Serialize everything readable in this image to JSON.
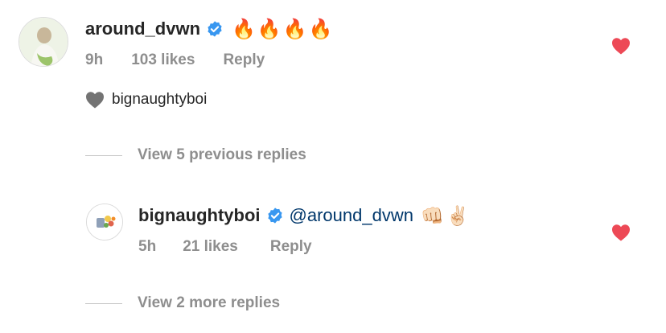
{
  "comment": {
    "username": "around_dvwn",
    "emojis": "🔥🔥🔥🔥",
    "time": "9h",
    "likes": "103 likes",
    "reply_label": "Reply",
    "liked_by": "bignaughtyboi"
  },
  "view_previous": "View 5 previous replies",
  "reply": {
    "username": "bignaughtyboi",
    "mention": "@around_dvwn",
    "emojis": "👊🏻✌🏻",
    "time": "5h",
    "likes": "21 likes",
    "reply_label": "Reply"
  },
  "view_more": "View 2 more replies",
  "colors": {
    "heart_liked": "#ed4956",
    "verified": "#3897f0",
    "mention": "#00376b",
    "muted": "#8e8e8e"
  }
}
